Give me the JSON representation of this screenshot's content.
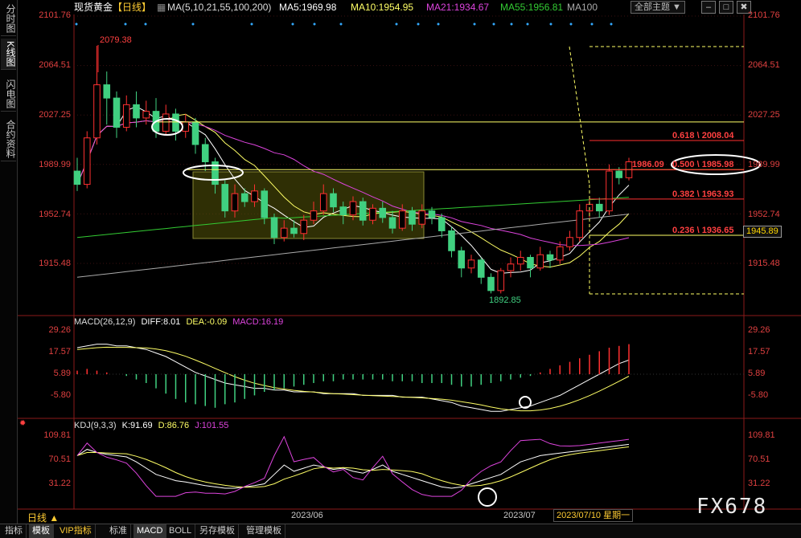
{
  "sidebar": {
    "tabs": [
      {
        "label": "分时图"
      },
      {
        "label": "K线图"
      },
      {
        "label": "闪电图"
      },
      {
        "label": "合约资料"
      }
    ]
  },
  "header": {
    "instrument": "现货黄金",
    "period_tag": "【日线】",
    "ma_params": "MA(5,10,21,55,100,200)",
    "ma5": "MA5:1969.98",
    "ma10": "MA10:1954.95",
    "ma21": "MA21:1934.67",
    "ma55": "MA55:1956.81",
    "ma100": "MA100",
    "theme_select": "全部主题",
    "btn_minimize": "–",
    "btn_restore": "□",
    "btn_close": "✖"
  },
  "price_axis": {
    "ticks": [
      "2101.76",
      "2064.51",
      "2027.25",
      "1989.99",
      "1952.74",
      "1915.48"
    ],
    "current_price": "1945.89"
  },
  "annotations": {
    "high": "2079.38",
    "low": "1892.85",
    "fib_618": "0.618 \\ 2008.04",
    "fib_500": "0.500 \\ 1985.98",
    "fib_382": "0.382 \\ 1963.93",
    "fib_236": "0.236 \\ 1936.65",
    "fib_500_prefix": "1986.09"
  },
  "macd": {
    "title": "MACD(26,12,9)",
    "diff": "DIFF:8.01",
    "dea": "DEA:-0.09",
    "macd": "MACD:16.19",
    "ticks": [
      "29.26",
      "17.57",
      "5.89",
      "-5.80"
    ]
  },
  "kdj": {
    "title": "KDJ(9,3,3)",
    "k": "K:91.69",
    "d": "D:86.76",
    "j": "J:101.55",
    "ticks": [
      "109.81",
      "70.51",
      "31.22"
    ]
  },
  "dates": {
    "d1": "2023/06",
    "d2": "2023/07",
    "current": "2023/07/10 星期一"
  },
  "period_label": "日线 ▲",
  "watermark": "FX678",
  "bottom_tabs": [
    {
      "label": "指标"
    },
    {
      "label": "模板"
    },
    {
      "label": "VIP指标"
    },
    {
      "label": "标准"
    },
    {
      "label": "MACD"
    },
    {
      "label": "BOLL"
    },
    {
      "label": "另存模板"
    },
    {
      "label": "管理模板"
    }
  ],
  "colors": {
    "up": "#ff3030",
    "down": "#40d080",
    "ma5": "#ffffff",
    "ma10": "#ffff66",
    "ma21": "#dd44dd",
    "ma55": "#33cc33",
    "ma100": "#aaaaaa",
    "fib": "#ff3030",
    "hline": "#ffff66"
  },
  "chart_data": {
    "type": "candlestick",
    "title": "现货黄金 日线",
    "candles": [
      [
        1985,
        1975,
        1995,
        1970
      ],
      [
        1975,
        2010,
        2015,
        1972
      ],
      [
        2010,
        2050,
        2079.38,
        2005
      ],
      [
        2050,
        2040,
        2060,
        2020
      ],
      [
        2040,
        2018,
        2045,
        2010
      ],
      [
        2018,
        2035,
        2042,
        2015
      ],
      [
        2035,
        2025,
        2045,
        2018
      ],
      [
        2025,
        2030,
        2038,
        2020
      ],
      [
        2030,
        2015,
        2040,
        2010
      ],
      [
        2015,
        2028,
        2035,
        2012
      ],
      [
        2028,
        2015,
        2032,
        2008
      ],
      [
        2015,
        2022,
        2028,
        2010
      ],
      [
        2022,
        2005,
        2025,
        1998
      ],
      [
        2005,
        1992,
        2010,
        1985
      ],
      [
        1992,
        1975,
        1995,
        1968
      ],
      [
        1975,
        1955,
        1978,
        1950
      ],
      [
        1955,
        1968,
        1975,
        1950
      ],
      [
        1968,
        1962,
        1972,
        1958
      ],
      [
        1962,
        1970,
        1975,
        1958
      ],
      [
        1970,
        1950,
        1972,
        1945
      ],
      [
        1950,
        1935,
        1953,
        1930
      ],
      [
        1935,
        1942,
        1948,
        1932
      ],
      [
        1942,
        1938,
        1948,
        1935
      ],
      [
        1938,
        1948,
        1952,
        1933
      ],
      [
        1948,
        1955,
        1962,
        1945
      ],
      [
        1955,
        1968,
        1975,
        1952
      ],
      [
        1968,
        1958,
        1972,
        1954
      ],
      [
        1958,
        1952,
        1962,
        1945
      ],
      [
        1952,
        1962,
        1966,
        1948
      ],
      [
        1962,
        1948,
        1965,
        1944
      ],
      [
        1948,
        1957,
        1960,
        1945
      ],
      [
        1957,
        1950,
        1962,
        1946
      ],
      [
        1950,
        1942,
        1955,
        1938
      ],
      [
        1942,
        1955,
        1960,
        1940
      ],
      [
        1955,
        1945,
        1958,
        1940
      ],
      [
        1945,
        1955,
        1960,
        1942
      ],
      [
        1955,
        1950,
        1958,
        1945
      ],
      [
        1950,
        1940,
        1953,
        1935
      ],
      [
        1940,
        1925,
        1943,
        1920
      ],
      [
        1925,
        1912,
        1928,
        1905
      ],
      [
        1912,
        1918,
        1922,
        1908
      ],
      [
        1918,
        1905,
        1920,
        1900
      ],
      [
        1905,
        1895,
        1908,
        1892.85
      ],
      [
        1895,
        1910,
        1912,
        1892.85
      ],
      [
        1910,
        1915,
        1920,
        1905
      ],
      [
        1915,
        1920,
        1925,
        1910
      ],
      [
        1920,
        1912,
        1922,
        1905
      ],
      [
        1912,
        1922,
        1928,
        1910
      ],
      [
        1922,
        1918,
        1925,
        1912
      ],
      [
        1918,
        1928,
        1932,
        1915
      ],
      [
        1928,
        1935,
        1940,
        1925
      ],
      [
        1935,
        1955,
        1960,
        1932
      ],
      [
        1955,
        1960,
        1965,
        1950
      ],
      [
        1960,
        1955,
        1965,
        1950
      ],
      [
        1955,
        1985,
        1990,
        1952
      ],
      [
        1985,
        1980,
        1988,
        1975
      ],
      [
        1980,
        1992,
        1995,
        1978
      ]
    ],
    "fib_levels": [
      2008.04,
      1985.98,
      1963.93,
      1936.65
    ],
    "ylim": [
      1892,
      2101.76
    ]
  }
}
